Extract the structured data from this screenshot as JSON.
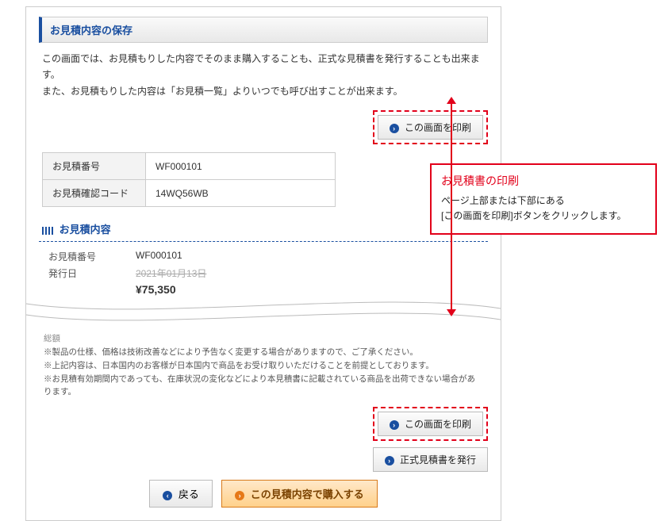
{
  "header": {
    "title": "お見積内容の保存"
  },
  "intro": {
    "line1": "この画面では、お見積もりした内容でそのまま購入することも、正式な見積書を発行することも出来ます。",
    "line2": "また、お見積もりした内容は「お見積一覧」よりいつでも呼び出すことが出来ます。"
  },
  "buttons": {
    "print": "この画面を印刷",
    "issue_quote": "正式見積書を発行",
    "back": "戻る",
    "purchase": "この見積内容で購入する"
  },
  "quote_table": {
    "rows": [
      {
        "label": "お見積番号",
        "value": "WF000101"
      },
      {
        "label": "お見積確認コード",
        "value": "14WQ56WB"
      }
    ]
  },
  "content_section": {
    "title": "お見積内容"
  },
  "details": {
    "quote_no_label": "お見積番号",
    "quote_no_value": "WF000101",
    "issue_date_label": "発行日",
    "issue_date_value": "2021年01月13日",
    "total_label": "総額",
    "price": "¥75,350"
  },
  "notes": {
    "n1": "※製品の仕様、価格は技術改善などにより予告なく変更する場合がありますので、ご了承ください。",
    "n2": "※上記内容は、日本国内のお客様が日本国内で商品をお受け取りいただけることを前提としております。",
    "n3": "※お見積有効期間内であっても、在庫状況の変化などにより本見積書に記載されている商品を出荷できない場合があります。"
  },
  "callout": {
    "title": "お見積書の印刷",
    "body": "ページ上部または下部にある\n[この画面を印刷]ボタンをクリックします。"
  }
}
